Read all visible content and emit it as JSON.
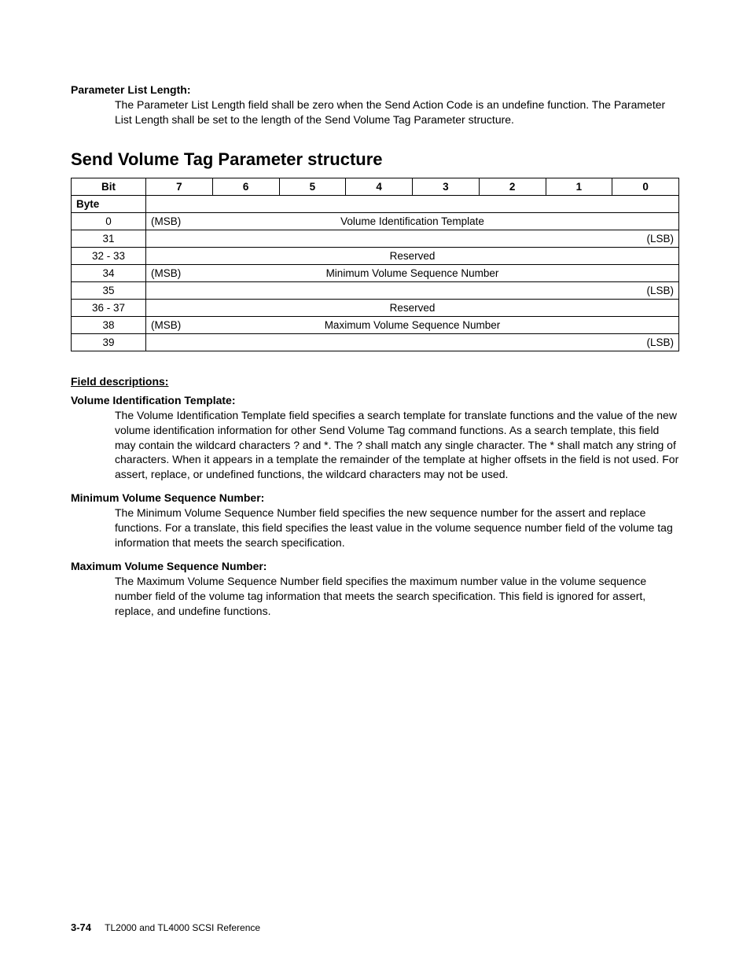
{
  "def_param_list_length": {
    "term": "Parameter List Length:",
    "body": "The Parameter List Length field shall be zero when the Send Action Code is an undefine function. The Parameter List Length shall be set to the length of the Send Volume Tag Parameter structure."
  },
  "section_heading": "Send Volume Tag Parameter structure",
  "table": {
    "corner_bit": "Bit",
    "corner_byte": "Byte",
    "bit_headers": [
      "7",
      "6",
      "5",
      "4",
      "3",
      "2",
      "1",
      "0"
    ],
    "rows": [
      {
        "byte": "0",
        "msb": "(MSB)",
        "center": "Volume Identification Template",
        "lsb": ""
      },
      {
        "byte": "31",
        "msb": "",
        "center": "",
        "lsb": "(LSB)"
      },
      {
        "byte": "32 - 33",
        "msb": "",
        "center": "Reserved",
        "lsb": ""
      },
      {
        "byte": "34",
        "msb": "(MSB)",
        "center": "Minimum Volume Sequence Number",
        "lsb": ""
      },
      {
        "byte": "35",
        "msb": "",
        "center": "",
        "lsb": "(LSB)"
      },
      {
        "byte": "36 - 37",
        "msb": "",
        "center": "Reserved",
        "lsb": ""
      },
      {
        "byte": "38",
        "msb": "(MSB)",
        "center": "Maximum Volume Sequence Number",
        "lsb": ""
      },
      {
        "byte": "39",
        "msb": "",
        "center": "",
        "lsb": "(LSB)"
      }
    ]
  },
  "field_desc_heading": "Field descriptions:",
  "def_vit": {
    "term": "Volume Identification Template:",
    "body": "The Volume Identification Template field specifies a search template for translate functions and the value of the new volume identification information for other Send Volume Tag command functions. As a search template, this field may contain the wildcard characters ? and *. The ? shall match any single character. The * shall match any string of characters. When it appears in a template the remainder of the template at higher offsets in the field is not used. For assert, replace, or undefined functions, the wildcard characters may not be used."
  },
  "def_minvsn": {
    "term": "Minimum Volume Sequence Number:",
    "body": "The Minimum Volume Sequence Number field specifies the new sequence number for the assert and replace functions. For a translate, this field specifies the least value in the volume sequence number field of the volume tag information that meets the search specification."
  },
  "def_maxvsn": {
    "term": "Maximum Volume Sequence Number:",
    "body": "The Maximum Volume Sequence Number field specifies the maximum number value in the volume sequence number field of the volume tag information that meets the search specification. This field is ignored for assert, replace, and undefine functions."
  },
  "footer": {
    "page": "3-74",
    "doc": "TL2000 and TL4000 SCSI Reference"
  }
}
